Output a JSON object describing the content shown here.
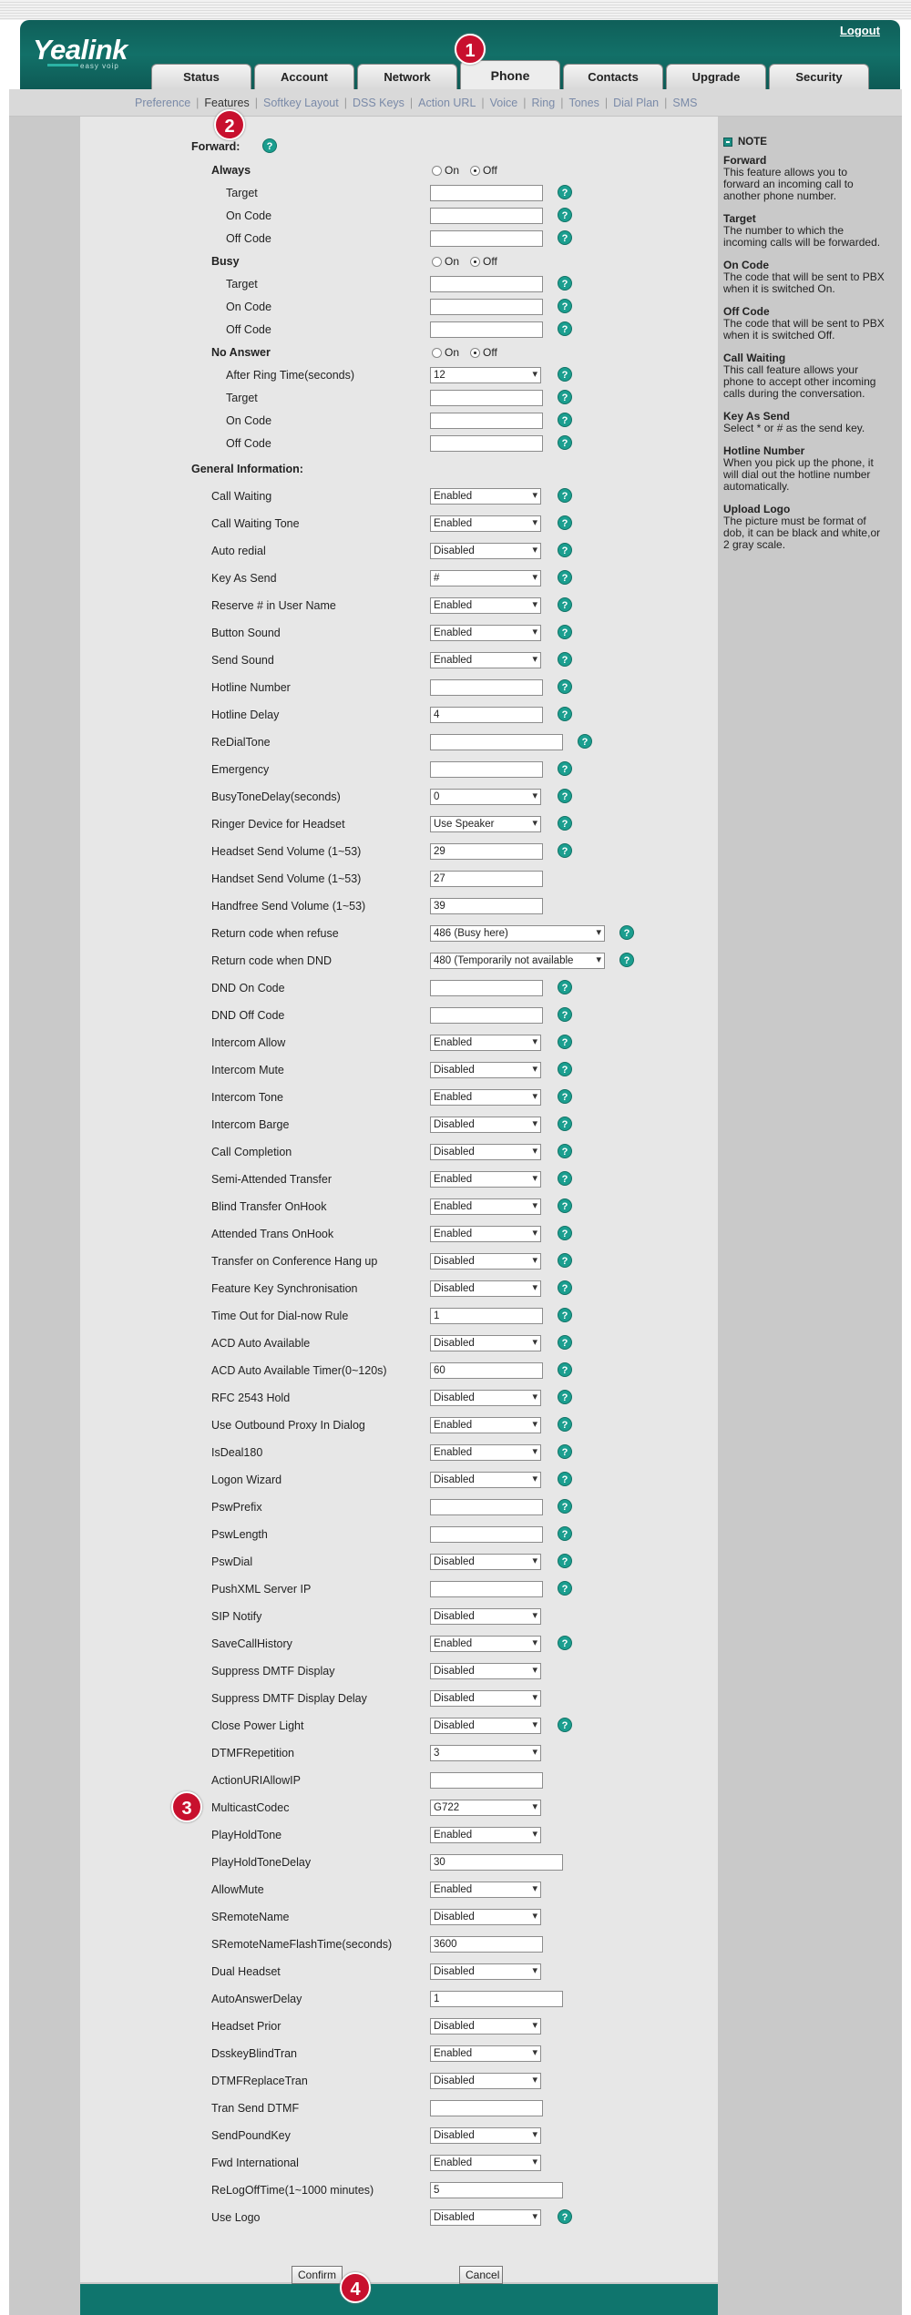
{
  "header": {
    "logo": "Yealink",
    "logo_sub": "easy voip",
    "logout": "Logout",
    "tabs": [
      "Status",
      "Account",
      "Network",
      "Phone",
      "Contacts",
      "Upgrade",
      "Security"
    ],
    "active_tab": "Phone"
  },
  "subnav": {
    "items": [
      "Preference",
      "Features",
      "Softkey Layout",
      "DSS Keys",
      "Action URL",
      "Voice",
      "Ring",
      "Tones",
      "Dial Plan",
      "SMS"
    ],
    "active": "Features"
  },
  "markers": [
    "1",
    "2",
    "3",
    "4"
  ],
  "forward": {
    "title": "Forward:",
    "on_label": "On",
    "off_label": "Off",
    "always": {
      "label": "Always",
      "target": "Target",
      "on_code": "On Code",
      "off_code": "Off Code"
    },
    "busy": {
      "label": "Busy",
      "target": "Target",
      "on_code": "On Code",
      "off_code": "Off Code"
    },
    "no_answer": {
      "label": "No Answer",
      "ring_time": "After Ring Time(seconds)",
      "ring_time_value": "12",
      "target": "Target",
      "on_code": "On Code",
      "off_code": "Off Code"
    }
  },
  "general": {
    "title": "General Information:",
    "rows": [
      {
        "label": "Call Waiting",
        "type": "select",
        "value": "Enabled",
        "help": true
      },
      {
        "label": "Call Waiting Tone",
        "type": "select",
        "value": "Enabled",
        "help": true
      },
      {
        "label": "Auto redial",
        "type": "select",
        "value": "Disabled",
        "help": true
      },
      {
        "label": "Key As Send",
        "type": "select",
        "value": "#",
        "help": true
      },
      {
        "label": "Reserve # in User Name",
        "type": "select",
        "value": "Enabled",
        "help": true
      },
      {
        "label": "Button Sound",
        "type": "select",
        "value": "Enabled",
        "help": true
      },
      {
        "label": "Send Sound",
        "type": "select",
        "value": "Enabled",
        "help": true
      },
      {
        "label": "Hotline Number",
        "type": "input",
        "value": "",
        "help": true
      },
      {
        "label": "Hotline Delay",
        "type": "input",
        "value": "4",
        "help": true
      },
      {
        "label": "ReDialTone",
        "type": "input-wide",
        "value": "",
        "help": true
      },
      {
        "label": "Emergency",
        "type": "input",
        "value": "",
        "help": true
      },
      {
        "label": "BusyToneDelay(seconds)",
        "type": "select",
        "value": "0",
        "help": true
      },
      {
        "label": "Ringer Device for Headset",
        "type": "select",
        "value": "Use Speaker",
        "help": true
      },
      {
        "label": "Headset Send Volume (1~53)",
        "type": "input",
        "value": "29",
        "help": true
      },
      {
        "label": "Handset Send Volume (1~53)",
        "type": "input",
        "value": "27",
        "help": false
      },
      {
        "label": "Handfree Send Volume (1~53)",
        "type": "input",
        "value": "39",
        "help": false
      },
      {
        "label": "Return code when refuse",
        "type": "select-wide",
        "value": "486 (Busy here)",
        "help": true
      },
      {
        "label": "Return code when DND",
        "type": "select-wide",
        "value": "480 (Temporarily not available",
        "help": true
      },
      {
        "label": "DND On Code",
        "type": "input",
        "value": "",
        "help": true
      },
      {
        "label": "DND Off Code",
        "type": "input",
        "value": "",
        "help": true
      },
      {
        "label": "Intercom Allow",
        "type": "select",
        "value": "Enabled",
        "help": true
      },
      {
        "label": "Intercom Mute",
        "type": "select",
        "value": "Disabled",
        "help": true
      },
      {
        "label": "Intercom Tone",
        "type": "select",
        "value": "Enabled",
        "help": true
      },
      {
        "label": "Intercom Barge",
        "type": "select",
        "value": "Disabled",
        "help": true
      },
      {
        "label": "Call Completion",
        "type": "select",
        "value": "Disabled",
        "help": true
      },
      {
        "label": "Semi-Attended Transfer",
        "type": "select",
        "value": "Enabled",
        "help": true
      },
      {
        "label": "Blind Transfer OnHook",
        "type": "select",
        "value": "Enabled",
        "help": true
      },
      {
        "label": "Attended Trans OnHook",
        "type": "select",
        "value": "Enabled",
        "help": true
      },
      {
        "label": "Transfer on Conference Hang up",
        "type": "select",
        "value": "Disabled",
        "help": true
      },
      {
        "label": "Feature Key Synchronisation",
        "type": "select",
        "value": "Disabled",
        "help": true
      },
      {
        "label": "Time Out for Dial-now Rule",
        "type": "input",
        "value": "1",
        "help": true
      },
      {
        "label": "ACD Auto Available",
        "type": "select",
        "value": "Disabled",
        "help": true
      },
      {
        "label": "ACD Auto Available Timer(0~120s)",
        "type": "input",
        "value": "60",
        "help": true
      },
      {
        "label": "RFC 2543 Hold",
        "type": "select",
        "value": "Disabled",
        "help": true
      },
      {
        "label": "Use Outbound Proxy In Dialog",
        "type": "select",
        "value": "Enabled",
        "help": true
      },
      {
        "label": "IsDeal180",
        "type": "select",
        "value": "Enabled",
        "help": true
      },
      {
        "label": "Logon Wizard",
        "type": "select",
        "value": "Disabled",
        "help": true
      },
      {
        "label": "PswPrefix",
        "type": "input",
        "value": "",
        "help": true
      },
      {
        "label": "PswLength",
        "type": "input",
        "value": "",
        "help": true
      },
      {
        "label": "PswDial",
        "type": "select",
        "value": "Disabled",
        "help": true
      },
      {
        "label": "PushXML Server IP",
        "type": "input",
        "value": "",
        "help": true
      },
      {
        "label": "SIP Notify",
        "type": "select",
        "value": "Disabled",
        "help": false
      },
      {
        "label": "SaveCallHistory",
        "type": "select",
        "value": "Enabled",
        "help": true
      },
      {
        "label": "Suppress DMTF Display",
        "type": "select",
        "value": "Disabled",
        "help": false
      },
      {
        "label": "Suppress DMTF Display Delay",
        "type": "select",
        "value": "Disabled",
        "help": false
      },
      {
        "label": "Close Power Light",
        "type": "select",
        "value": "Disabled",
        "help": true
      },
      {
        "label": "DTMFRepetition",
        "type": "select",
        "value": "3",
        "help": false
      },
      {
        "label": "ActionURIAllowIP",
        "type": "input",
        "value": "",
        "help": false
      },
      {
        "label": "MulticastCodec",
        "type": "select",
        "value": "G722",
        "help": false
      },
      {
        "label": "PlayHoldTone",
        "type": "select",
        "value": "Enabled",
        "help": false
      },
      {
        "label": "PlayHoldToneDelay",
        "type": "input-wide",
        "value": "30",
        "help": false
      },
      {
        "label": "AllowMute",
        "type": "select",
        "value": "Enabled",
        "help": false
      },
      {
        "label": "SRemoteName",
        "type": "select",
        "value": "Disabled",
        "help": false
      },
      {
        "label": "SRemoteNameFlashTime(seconds)",
        "type": "input",
        "value": "3600",
        "help": false
      },
      {
        "label": "Dual Headset",
        "type": "select",
        "value": "Disabled",
        "help": false
      },
      {
        "label": "AutoAnswerDelay",
        "type": "input-wide",
        "value": "1",
        "help": false
      },
      {
        "label": "Headset Prior",
        "type": "select",
        "value": "Disabled",
        "help": false
      },
      {
        "label": "DsskeyBlindTran",
        "type": "select",
        "value": "Enabled",
        "help": false
      },
      {
        "label": "DTMFReplaceTran",
        "type": "select",
        "value": "Disabled",
        "help": false
      },
      {
        "label": "Tran Send DTMF",
        "type": "input",
        "value": "",
        "help": false
      },
      {
        "label": "SendPoundKey",
        "type": "select",
        "value": "Disabled",
        "help": false
      },
      {
        "label": "Fwd International",
        "type": "select",
        "value": "Enabled",
        "help": false
      },
      {
        "label": "ReLogOffTime(1~1000 minutes)",
        "type": "input-wide",
        "value": "5",
        "help": false
      },
      {
        "label": "Use Logo",
        "type": "select",
        "value": "Disabled",
        "help": true
      }
    ]
  },
  "buttons": {
    "confirm": "Confirm",
    "cancel": "Cancel"
  },
  "note": {
    "title": "NOTE",
    "items": [
      {
        "title": "Forward",
        "text": "This feature allows you to forward an incoming call to another phone number."
      },
      {
        "title": "Target",
        "text": "The number to which the incoming calls will be forwarded."
      },
      {
        "title": "On Code",
        "text": "The code that will be sent to PBX when it is switched On."
      },
      {
        "title": "Off Code",
        "text": "The code that will be sent to PBX when it is switched Off."
      },
      {
        "title": "Call Waiting",
        "text": "This call feature allows your phone to accept other incoming calls during the conversation."
      },
      {
        "title": "Key As Send",
        "text": "Select * or # as the send key."
      },
      {
        "title": "Hotline Number",
        "text": "When you pick up the phone, it will dial out the hotline number automatically."
      },
      {
        "title": "Upload Logo",
        "text": "The picture must be format of dob, it can be black and white,or 2 gray scale."
      }
    ]
  },
  "colors": {
    "header": "#127068",
    "accent": "#1b9e8f",
    "marker": "#c8102e"
  }
}
